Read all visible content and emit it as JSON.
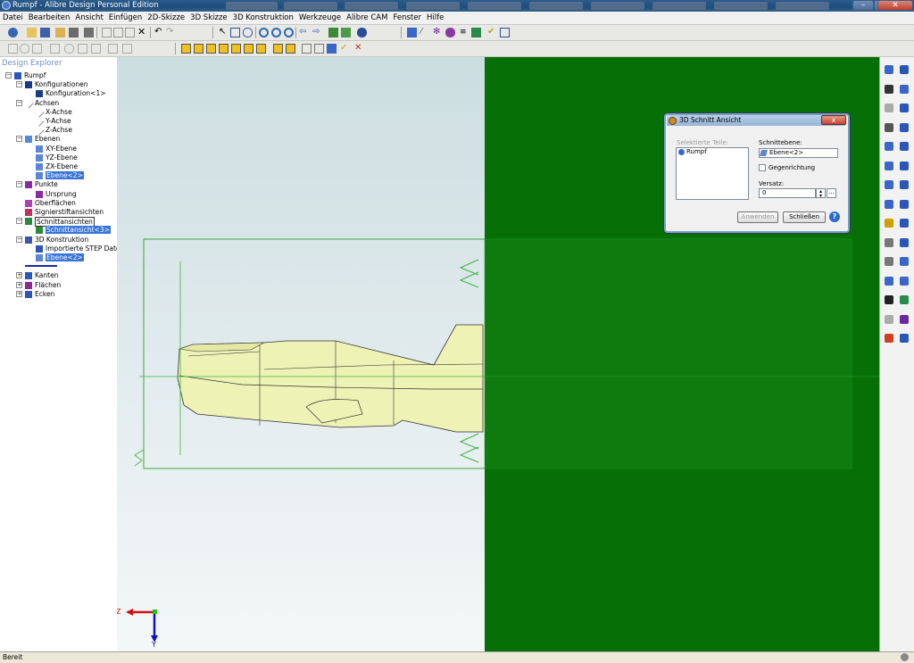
{
  "window": {
    "title": "Rumpf - Alibre Design Personal Edition",
    "min_label": "–",
    "max_label": "□",
    "close_label": "✕"
  },
  "menu": [
    "Datei",
    "Bearbeiten",
    "Ansicht",
    "Einfügen",
    "2D-Skizze",
    "3D Skizze",
    "3D Konstruktion",
    "Werkzeuge",
    "Alibre CAM",
    "Fenster",
    "Hilfe"
  ],
  "explorer": {
    "header": "Design Explorer",
    "tree": [
      {
        "label": "Rumpf",
        "icon": "part-icon",
        "level": 0,
        "expand": "−"
      },
      {
        "label": "Konfigurationen",
        "icon": "config-icon",
        "level": 1,
        "expand": "−"
      },
      {
        "label": "Konfiguration<1>",
        "icon": "config-icon",
        "level": 2
      },
      {
        "label": "Achsen",
        "icon": "axis-icon",
        "level": 1,
        "expand": "−"
      },
      {
        "label": "X-Achse",
        "icon": "axis-icon",
        "level": 2
      },
      {
        "label": "Y-Achse",
        "icon": "axis-icon",
        "level": 2
      },
      {
        "label": "Z-Achse",
        "icon": "axis-icon",
        "level": 2
      },
      {
        "label": "Ebenen",
        "icon": "plane-icon",
        "level": 1,
        "expand": "−"
      },
      {
        "label": "XY-Ebene",
        "icon": "plane-icon",
        "level": 2
      },
      {
        "label": "YZ-Ebene",
        "icon": "plane-icon",
        "level": 2
      },
      {
        "label": "ZX-Ebene",
        "icon": "plane-icon",
        "level": 2
      },
      {
        "label": "Ebene<2>",
        "icon": "plane-icon",
        "level": 2,
        "selected": true
      },
      {
        "label": "Punkte",
        "icon": "point-icon",
        "level": 1,
        "expand": "−"
      },
      {
        "label": "Ursprung",
        "icon": "point-icon",
        "level": 2
      },
      {
        "label": "Oberflächen",
        "icon": "surface-icon",
        "level": 1
      },
      {
        "label": "Signierstiftansichten",
        "icon": "sketch-icon",
        "level": 1
      },
      {
        "label": "Schnittansichten",
        "icon": "section-icon",
        "level": 1,
        "expand": "−",
        "boxed": true
      },
      {
        "label": "Schnittansicht<3>",
        "icon": "section-icon",
        "level": 2,
        "selected": true
      },
      {
        "label": "3D Konstruktion",
        "icon": "construction-icon",
        "level": 1,
        "expand": "−"
      },
      {
        "label": "Importierte STEP Datei",
        "icon": "step-icon",
        "level": 2
      },
      {
        "label": "Ebene<2>",
        "icon": "plane-icon",
        "level": 2,
        "selected": true
      },
      {
        "label": "",
        "icon": "rollback-bar-icon",
        "level": 1
      },
      {
        "label": "Kanten",
        "icon": "edges-icon",
        "level": 1,
        "expand": "+"
      },
      {
        "label": "Flächen",
        "icon": "faces-icon",
        "level": 1,
        "expand": "+"
      },
      {
        "label": "Ecken",
        "icon": "vertices-icon",
        "level": 1,
        "expand": "+"
      }
    ]
  },
  "viewport": {
    "axis_z": "Z",
    "axis_y": "Y"
  },
  "dialog": {
    "title": "3D Schnitt Ansicht",
    "close": "x",
    "selected_parts_label": "Selektierte Teile:",
    "selected_parts": [
      "Rumpf"
    ],
    "plane_label": "Schnittebene:",
    "plane_value": "Ebene<2>",
    "reverse_label": "Gegenrichtung",
    "reverse_checked": false,
    "offset_label": "Versatz:",
    "offset_value": "0",
    "more_label": "...",
    "apply_label": "Anwenden",
    "close_label": "Schließen",
    "help_label": "?"
  },
  "status": {
    "text": "Bereit"
  },
  "colors": {
    "section_green": "#067006",
    "dialog_frame": "#2e3e52",
    "selection": "#3874d8",
    "model_fill": "#eef2b4"
  }
}
